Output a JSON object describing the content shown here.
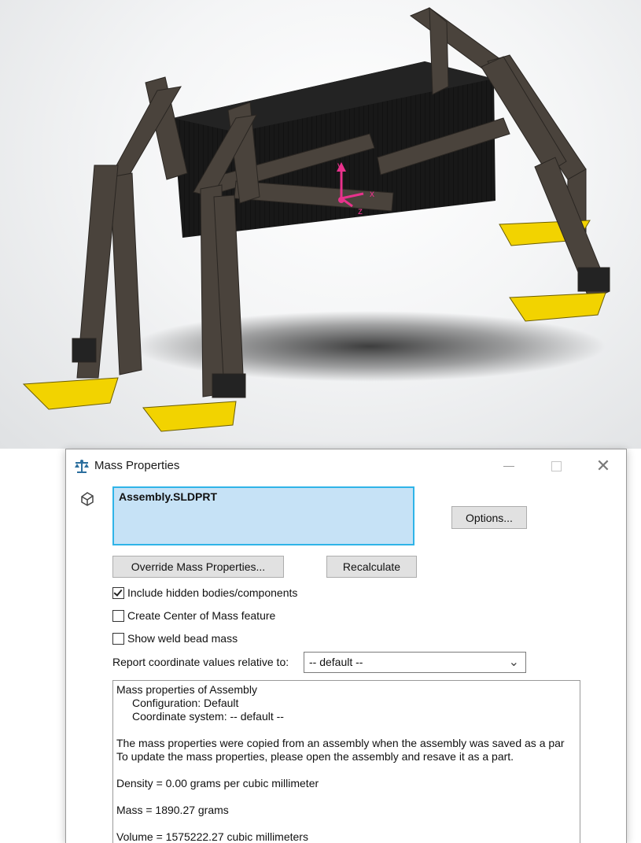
{
  "window": {
    "title": "Mass Properties",
    "min_glyph": "—",
    "close_glyph": "✕"
  },
  "selection": {
    "item": "Assembly.SLDPRT"
  },
  "buttons": {
    "options": "Options...",
    "override": "Override Mass Properties...",
    "recalculate": "Recalculate"
  },
  "checkboxes": {
    "include_hidden": {
      "label": "Include hidden bodies/components",
      "checked": true
    },
    "create_com": {
      "label": "Create Center of Mass feature",
      "checked": false
    },
    "show_weld": {
      "label": "Show weld bead mass",
      "checked": false
    }
  },
  "coordinates": {
    "label": "Report coordinate values relative to:",
    "selected": "-- default --"
  },
  "results": {
    "header": "Mass properties of Assembly",
    "configuration": "Configuration: Default",
    "coord_system": "Coordinate system: -- default --",
    "note1": "The mass properties were copied from an assembly when the assembly was saved as a par",
    "note2": "To update the mass properties, please open the assembly and resave it as a part.",
    "density": "Density = 0.00 grams per cubic millimeter",
    "mass": "Mass = 1890.27 grams",
    "volume": "Volume = 1575222.27 cubic millimeters"
  },
  "viewport": {
    "axis_labels": {
      "x": "x",
      "y": "y",
      "z": "z"
    },
    "colors": {
      "legs": "#4a433c",
      "body": "#151515",
      "feet": "#f2d300",
      "triad": "#e8328c"
    }
  }
}
